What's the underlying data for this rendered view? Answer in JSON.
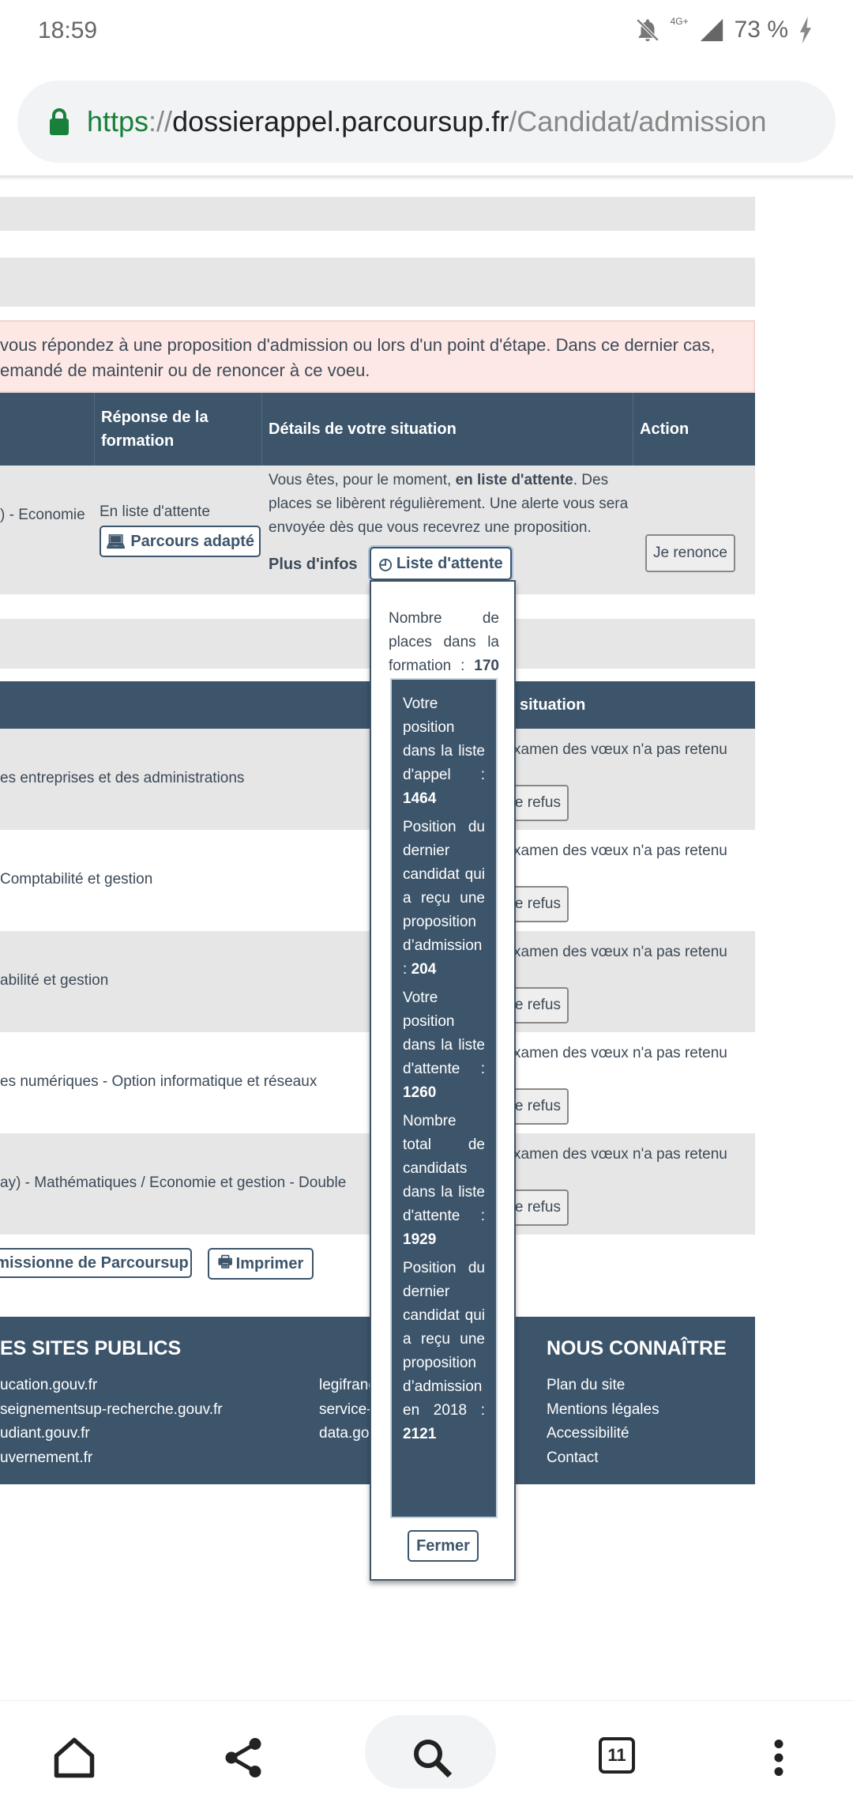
{
  "status_bar": {
    "time": "18:59",
    "battery": "73 %",
    "network": "4G+"
  },
  "browser": {
    "url_scheme": "https",
    "url_sep": "://",
    "url_host": "dossierappel.parcoursup.fr",
    "url_path": "/Candidat/admission"
  },
  "notice": {
    "line1": "vous répondez à une proposition d'admission ou lors d'un point d'étape. Dans ce dernier cas,",
    "line2": "emandé de maintenir ou de renoncer à ce voeu."
  },
  "table1": {
    "headers": {
      "response": "Réponse de la formation",
      "details": "Détails de votre situation",
      "action": "Action"
    },
    "row": {
      "formation": ") - Economie",
      "response": "En liste d'attente",
      "parcours_btn": "Parcours adapté",
      "details_pre": "Vous êtes, pour le moment, ",
      "details_bold": "en liste d'attente",
      "details_post": ". Des places se libèrent régulièrement. Une alerte vous sera envoyée dès que vous recevrez une proposition.",
      "plus_infos": "Plus d'infos",
      "waitlist_btn": "Liste d'attente",
      "renounce_btn": "Je renonce"
    }
  },
  "table2": {
    "header": "situation",
    "rows": [
      {
        "formation": "es entreprises et des administrations",
        "situation": "xamen des vœux n'a pas retenu",
        "button": "e refus"
      },
      {
        "formation": "Comptabilité et gestion",
        "situation": "xamen des vœux n'a pas retenu",
        "button": "e refus"
      },
      {
        "formation": "abilité et gestion",
        "situation": "xamen des vœux n'a pas retenu",
        "button": "e refus"
      },
      {
        "formation": "es numériques - Option informatique et réseaux",
        "situation": "xamen des vœux n'a pas retenu",
        "button": "e refus"
      },
      {
        "formation": "ay) - Mathématiques / Economie et gestion - Double",
        "situation": "xamen des vœux n'a pas retenu",
        "button": "e refus"
      }
    ]
  },
  "actions": {
    "commission": "missionne de Parcoursup",
    "print": "Imprimer"
  },
  "popover": {
    "places_label": "Nombre de places dans la formation :",
    "places_value": "170",
    "items": [
      {
        "label": "Votre position dans la liste d'appel :",
        "value": "1464"
      },
      {
        "label": "Position du dernier candidat qui a reçu une proposition d’admission :",
        "value": "204"
      },
      {
        "label": "Votre position dans la liste d'attente :",
        "value": "1260"
      },
      {
        "label": "Nombre total de candidats dans la liste d'attente :",
        "value": "1929"
      },
      {
        "label": "Position du dernier candidat qui a reçu une proposition d’admission en 2018 :",
        "value": "2121"
      }
    ],
    "close": "Fermer"
  },
  "footer": {
    "public_title": "ES SITES PUBLICS",
    "public_links": [
      "ucation.gouv.fr",
      "seignementsup-recherche.gouv.fr",
      "udiant.gouv.fr",
      "uvernement.fr"
    ],
    "mid_links": [
      "legifrance.gouv.fr",
      "service-public.fr",
      "data.gouv.fr"
    ],
    "about_title": "NOUS CONNAÎTRE",
    "about_links": [
      "Plan du site",
      "Mentions légales",
      "Accessibilité",
      "Contact"
    ]
  },
  "nav": {
    "tabs_count": "11"
  }
}
